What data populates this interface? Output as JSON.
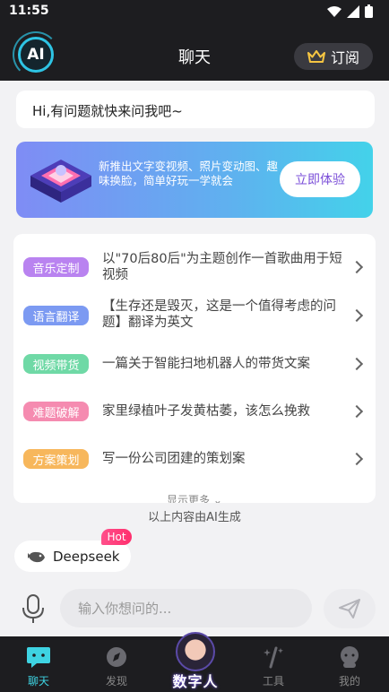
{
  "status_bar": {
    "time": "11:55"
  },
  "header": {
    "logo_text": "AI",
    "title": "聊天",
    "subscribe_label": "订阅"
  },
  "greeting": "Hi,有问题就快来问我吧~",
  "banner": {
    "text": "新推出文字变视频、照片变动图、趣味换脸，简单好玩一学就会",
    "button_label": "立即体验"
  },
  "prompts": [
    {
      "tag": "音乐定制",
      "color": "#b983f0",
      "text": "以\"70后80后\"为主题创作一首歌曲用于短视频"
    },
    {
      "tag": "语言翻译",
      "color": "#7c9af2",
      "text": "【生存还是毁灭，这是一个值得考虑的问题】翻译为英文"
    },
    {
      "tag": "视频带货",
      "color": "#6fd9a6",
      "text": "一篇关于智能扫地机器人的带货文案"
    },
    {
      "tag": "难题破解",
      "color": "#f58bb0",
      "text": "家里绿植叶子发黄枯萎，该怎么挽救"
    },
    {
      "tag": "方案策划",
      "color": "#f7b75c",
      "text": "写一份公司团建的策划案"
    }
  ],
  "show_more": "显示更多",
  "ai_notice": "以上内容由AI生成",
  "model_chip": {
    "label": "Deepseek",
    "badge": "Hot"
  },
  "input": {
    "placeholder": "输入你想问的..."
  },
  "tabs": [
    {
      "label": "聊天",
      "icon": "chat-icon",
      "active": true
    },
    {
      "label": "发现",
      "icon": "compass-icon",
      "active": false
    },
    {
      "label": "数字人",
      "icon": "digital-human-avatar",
      "active": false
    },
    {
      "label": "工具",
      "icon": "tools-icon",
      "active": false
    },
    {
      "label": "我的",
      "icon": "profile-icon",
      "active": false
    }
  ],
  "colors": {
    "accent": "#3ed3e2",
    "dark_bg": "#1d1d20",
    "banner_button_text": "#7a4dd8"
  }
}
